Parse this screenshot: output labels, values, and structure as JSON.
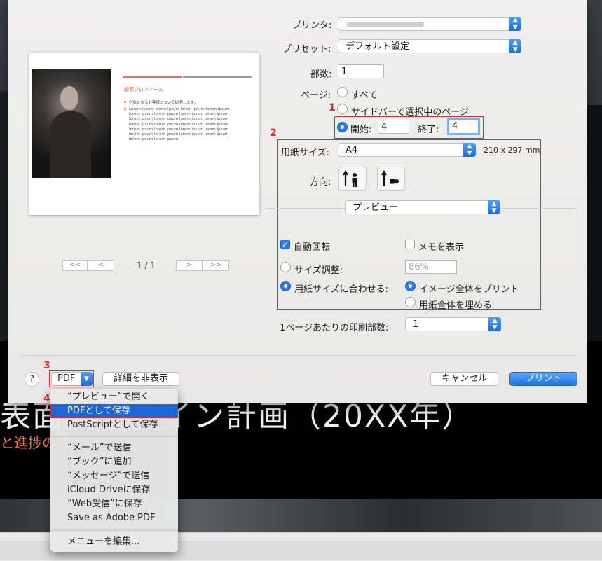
{
  "background": {
    "big_text": "表面のデザイン計画（20XX年）",
    "sub_text": "と進捗の状"
  },
  "preview": {
    "slide_title": "顧客プロフィール",
    "bullet1": "対象となるお客様について説明します。",
    "lorem": "Lorem ipsum lorem ipsum lorem ipsum lorem ipsum lorem ipsum lorem ipsum lorem ipsum lorem ipsum lorem ipsum lorem ipsum lorem ipsum lorem ipsum lorem ipsum lorem ipsum lorem ipsum lorem ipsum lorem ipsum lorem ipsum lorem ipsum lorem ipsum lorem ipsum lorem ipsum lorem ipsum lorem ipsum lorem ipsum lorem ipsum.",
    "nav_first": "<<",
    "nav_prev": "<",
    "nav_next": ">",
    "nav_last": ">>",
    "page_count": "1 / 1"
  },
  "printer": {
    "label": "プリンタ:",
    "value": ""
  },
  "preset": {
    "label": "プリセット:",
    "value": "デフォルト設定"
  },
  "copies": {
    "label": "部数:",
    "value": "1"
  },
  "pages": {
    "label": "ページ:",
    "all": "すべて",
    "selected": "サイドバーで選択中のページ",
    "from_label": "開始:",
    "from_value": "4",
    "to_label": "終了:",
    "to_value": "4"
  },
  "paper": {
    "label": "用紙サイズ:",
    "value": "A4",
    "dims": "210 x 297 mm"
  },
  "orientation": {
    "label": "方向:"
  },
  "app_section": {
    "value": "プレビュー"
  },
  "options": {
    "auto_rotate": "自動回転",
    "show_notes": "メモを表示",
    "scale_label": "サイズ調整:",
    "scale_value": "86%",
    "fit_label": "用紙サイズに合わせる:",
    "print_entire": "イメージ全体をプリント",
    "fill_paper": "用紙全体を埋める"
  },
  "per_sheet": {
    "label": "1ページあたりの印刷部数:",
    "value": "1"
  },
  "footer": {
    "help": "?",
    "pdf": "PDF",
    "hide_details": "詳細を非表示",
    "cancel": "キャンセル",
    "print": "プリント"
  },
  "annotations": {
    "n1": "1",
    "n2": "2",
    "n3": "3",
    "n4": "4"
  },
  "pdf_menu": {
    "items_top": [
      "“プレビュー”で開く",
      "PDFとして保存",
      "PostScriptとして保存"
    ],
    "items_mid": [
      "“メール”で送信",
      "“ブック”に追加",
      "“メッセージ”で送信",
      "iCloud Driveに保存",
      "“Web受信”に保存",
      "Save as Adobe PDF"
    ],
    "items_bottom": [
      "メニューを編集..."
    ]
  },
  "colors": {
    "accent": "#1e66d6",
    "annotation": "#e02a2a",
    "slide_accent": "#e8734a"
  }
}
